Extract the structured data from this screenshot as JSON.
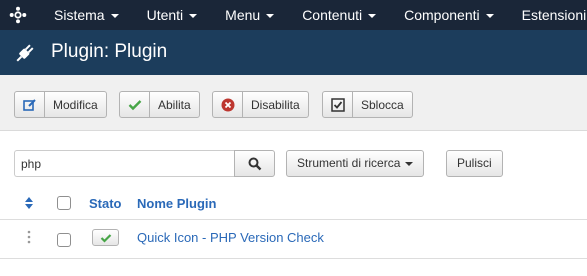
{
  "menu": {
    "items": [
      {
        "label": "Sistema"
      },
      {
        "label": "Utenti"
      },
      {
        "label": "Menu"
      },
      {
        "label": "Contenuti"
      },
      {
        "label": "Componenti"
      },
      {
        "label": "Estensioni"
      }
    ]
  },
  "header": {
    "title": "Plugin: Plugin",
    "icon": "plug-icon"
  },
  "toolbar": {
    "edit_label": "Modifica",
    "enable_label": "Abilita",
    "disable_label": "Disabilita",
    "checkin_label": "Sblocca"
  },
  "search": {
    "value": "php",
    "tools_label": "Strumenti di ricerca",
    "clear_label": "Pulisci"
  },
  "table": {
    "headers": {
      "status": "Stato",
      "name": "Nome Plugin"
    },
    "rows": [
      {
        "name": "Quick Icon - PHP Version Check",
        "enabled": true
      }
    ]
  },
  "colors": {
    "navbar": "#1a2638",
    "titlebar": "#1c3d5c",
    "link": "#2a69b8",
    "success": "#46a546",
    "danger": "#bd362f"
  }
}
